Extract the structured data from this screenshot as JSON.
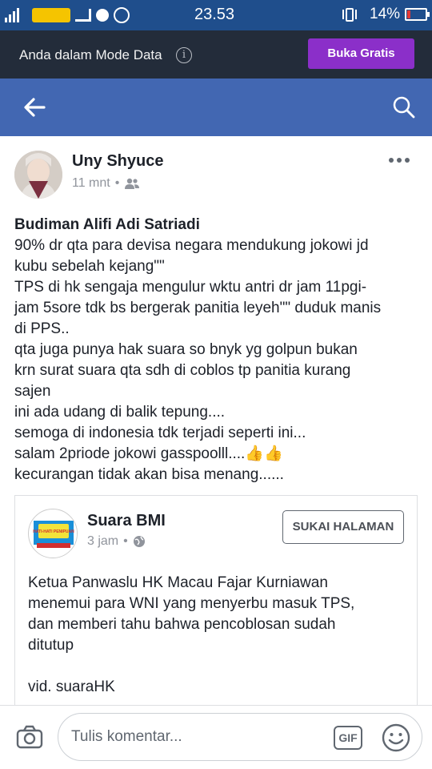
{
  "status_bar": {
    "network": "3G",
    "time": "23.53",
    "battery_percent": "14%",
    "battery_level": 0.14,
    "icons": [
      "signal-icon",
      "signal-icon",
      "app-icon",
      "notification-icon",
      "signal-icon",
      "sim-icon",
      "location-icon",
      "whatsapp-icon",
      "vibrate-icon",
      "battery-icon"
    ]
  },
  "data_mode": {
    "text": "Anda dalam Mode Data",
    "info_icon": "i",
    "button": "Buka Gratis",
    "button_color": "#8b2fc9"
  },
  "navbar": {
    "color": "#4267b2",
    "back_icon": "back-arrow-icon",
    "search_icon": "search-icon"
  },
  "post": {
    "author": "Uny Shyuce",
    "time": "11 mnt",
    "separator": "•",
    "audience_icon": "friends-icon",
    "body": [
      "Budiman Alifi Adi Satriadi",
      "90% dr qta para devisa negara mendukung jokowi jd",
      "kubu sebelah kejang\"\"",
      "TPS di hk sengaja mengulur wktu antri dr jam 11pgi-",
      "jam 5sore tdk bs bergerak panitia leyeh\"\" duduk manis",
      "di PPS..",
      "qta juga punya hak suara so bnyk yg golpun bukan",
      "krn surat suara qta sdh di coblos tp panitia kurang",
      "sajen",
      "ini ada udang di balik tepung....",
      "semoga di indonesia tdk terjadi seperti ini...",
      "salam 2priode jokowi gasspoolll....👍👍",
      "kecurangan tidak akan bisa menang......"
    ],
    "shared": {
      "page_name": "Suara BMI",
      "time": "3 jam",
      "separator": "•",
      "globe_icon": "globe-icon",
      "like_button": "SUKAI HALAMAN",
      "logo_text": "HATI-HATI PENIPUAN",
      "caption": [
        "Ketua Panwaslu HK Macau Fajar Kurniawan",
        "menemui para WNI yang menyerbu masuk TPS,",
        "dan memberi tahu bahwa pencoblosan sudah",
        "ditutup",
        "",
        "vid. suaraHK"
      ]
    }
  },
  "comment_bar": {
    "placeholder": "Tulis komentar...",
    "gif_label": "GIF",
    "camera_icon": "camera-icon",
    "emoji_icon": "emoji-icon"
  }
}
